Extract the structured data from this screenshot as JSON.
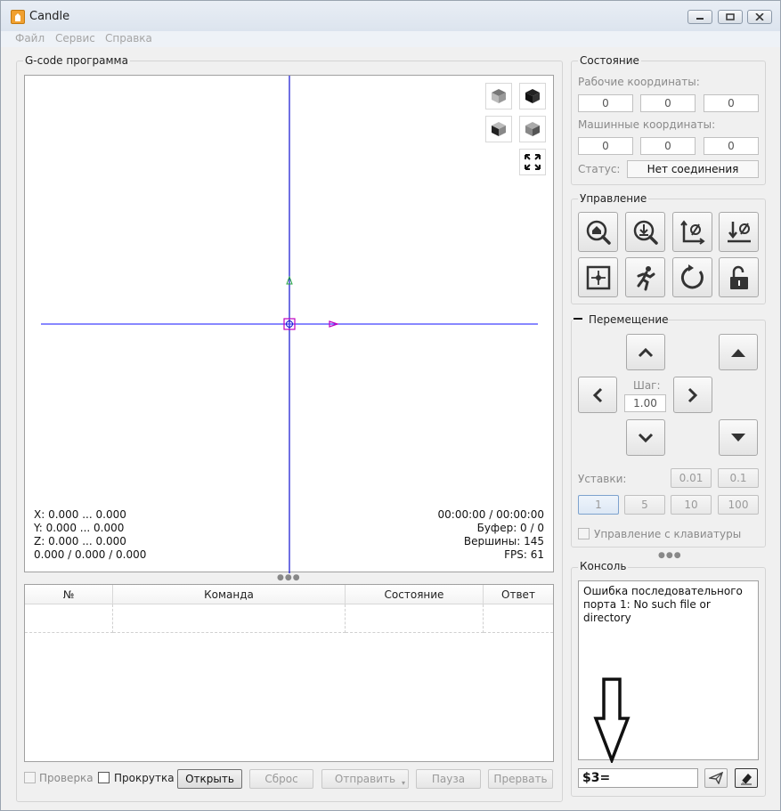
{
  "window": {
    "title": "Candle"
  },
  "menu": [
    "Файл",
    "Сервис",
    "Справка"
  ],
  "program": {
    "group_title": "G-code программа",
    "info_left": [
      "X: 0.000 ... 0.000",
      "Y: 0.000 ... 0.000",
      "Z: 0.000 ... 0.000",
      "0.000 / 0.000 / 0.000"
    ],
    "info_right": [
      "00:00:00 / 00:00:00",
      "Буфер: 0 / 0",
      "Вершины: 145",
      "FPS: 61"
    ],
    "table_headers": [
      "№",
      "Команда",
      "Состояние",
      "Ответ"
    ],
    "check_label": "Проверка",
    "scroll_label": "Прокрутка",
    "buttons": {
      "open": "Открыть",
      "reset": "Сброс",
      "send": "Отправить",
      "pause": "Пауза",
      "abort": "Прервать"
    }
  },
  "state": {
    "group_title": "Состояние",
    "work_label": "Рабочие координаты:",
    "work_coords": [
      "0",
      "0",
      "0"
    ],
    "machine_label": "Машинные координаты:",
    "machine_coords": [
      "0",
      "0",
      "0"
    ],
    "status_label": "Статус:",
    "status_value": "Нет соединения"
  },
  "control": {
    "group_title": "Управление",
    "icons": [
      "home-icon",
      "probe-icon",
      "zero-xy-icon",
      "zero-z-icon",
      "restore-origin-icon",
      "safe-position-icon",
      "reset-icon",
      "unlock-icon"
    ]
  },
  "jog": {
    "group_title": "Перемещение",
    "step_label": "Шаг:",
    "step_value": "1.00",
    "presets_label": "Уставки:",
    "presets_row1": [
      "0.01",
      "0.1"
    ],
    "presets_row2": [
      "1",
      "5",
      "10",
      "100"
    ],
    "keyboard_label": "Управление с клавиатуры"
  },
  "console": {
    "group_title": "Консоль",
    "message": "Ошибка последовательного порта 1: No such file or directory",
    "input_value": "$3="
  },
  "colors": {
    "y_axis": "#1010d0",
    "x_axis": "#4040ff",
    "tool": "#c000c0",
    "arrow_y": "#20a040",
    "arrow_x": "#c000c0"
  }
}
